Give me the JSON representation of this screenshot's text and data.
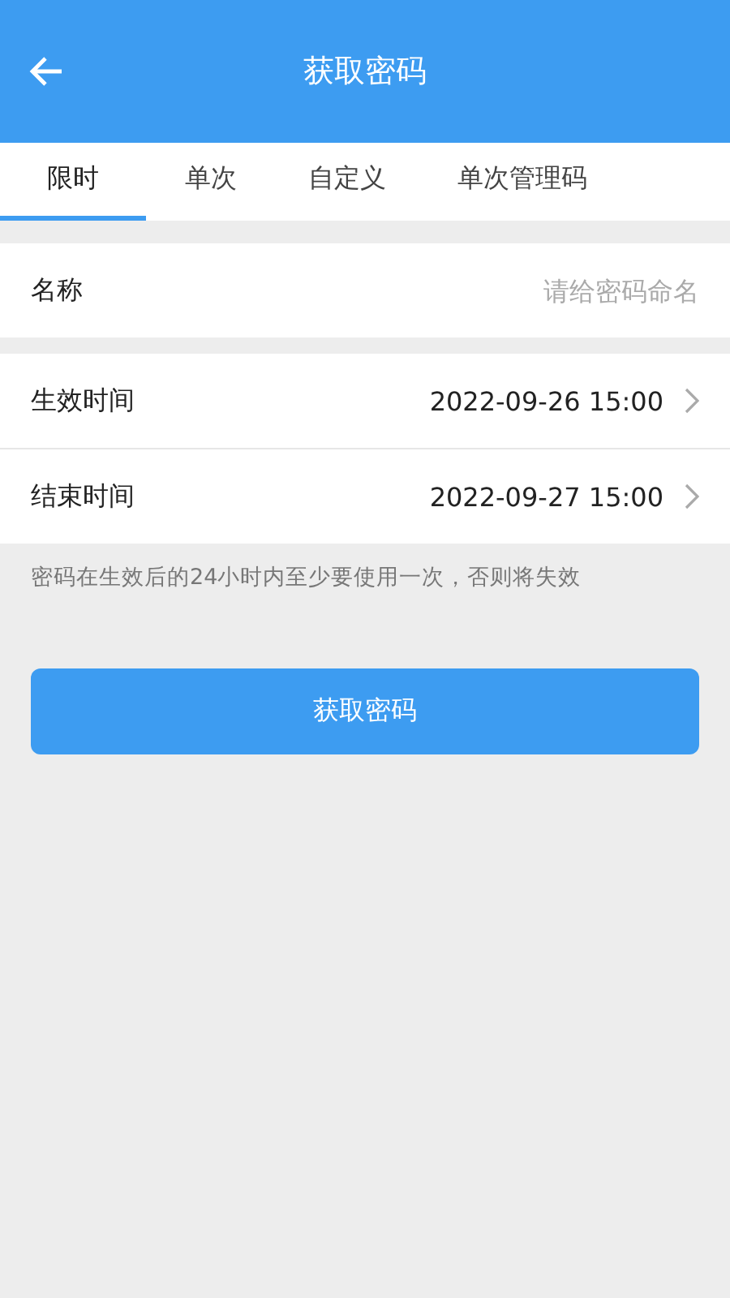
{
  "header": {
    "title": "获取密码"
  },
  "tabs": [
    {
      "label": "限时",
      "selected": true
    },
    {
      "label": "单次",
      "selected": false
    },
    {
      "label": "自定义",
      "selected": false
    },
    {
      "label": "单次管理码",
      "selected": false
    }
  ],
  "name_field": {
    "label": "名称",
    "placeholder": "请给密码命名"
  },
  "time_rows": [
    {
      "label": "生效时间",
      "value": "2022-09-26 15:00"
    },
    {
      "label": "结束时间",
      "value": "2022-09-27 15:00"
    }
  ],
  "note": "密码在生效后的24小时内至少要使用一次，否则将失效",
  "submit_button": "获取密码"
}
